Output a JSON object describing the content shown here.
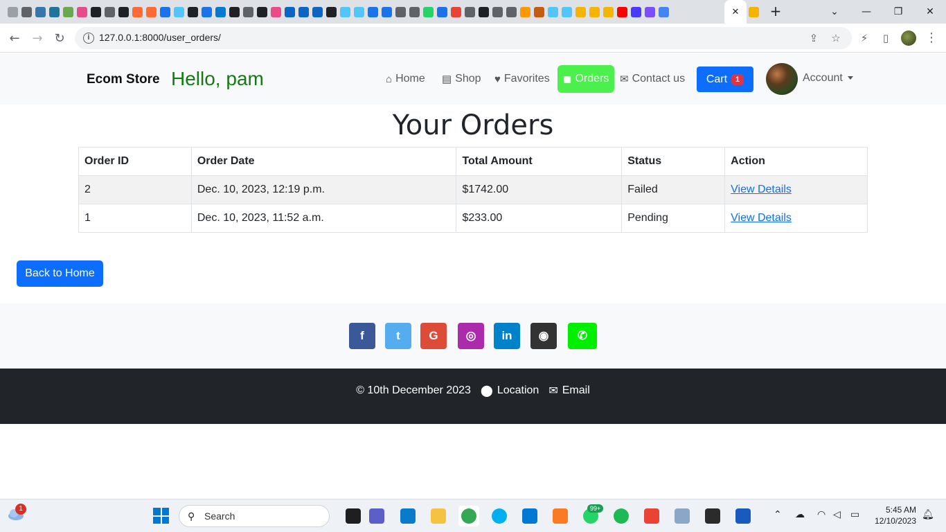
{
  "browser": {
    "url": "127.0.0.1:8000/user_orders/",
    "tab_close": "✕",
    "new_tab": "+"
  },
  "site": {
    "brand": "Ecom Store",
    "greeting": "Hello, pam",
    "nav": {
      "home": "Home",
      "shop": "Shop",
      "favorites": "Favorites",
      "orders": "Orders",
      "contact": "Contact us"
    },
    "cart_label": "Cart",
    "cart_count": "1",
    "account_label": "Account",
    "colors": {
      "primary": "#0d6efd",
      "active_nav": "#4cf04c",
      "greeting": "#157a15",
      "badge": "#dc3545",
      "footer_dark": "#212529"
    }
  },
  "main": {
    "title": "Your Orders",
    "table": {
      "headers": [
        "Order ID",
        "Order Date",
        "Total Amount",
        "Status",
        "Action"
      ],
      "rows": [
        {
          "id": "2",
          "date": "Dec. 10, 2023, 12:19 p.m.",
          "total": "$1742.00",
          "status": "Failed",
          "action": "View Details"
        },
        {
          "id": "1",
          "date": "Dec. 10, 2023, 11:52 a.m.",
          "total": "$233.00",
          "status": "Pending",
          "action": "View Details"
        }
      ]
    },
    "back_button": "Back to Home"
  },
  "footer": {
    "social": [
      {
        "name": "facebook",
        "glyph": "f",
        "color": "#3b5998"
      },
      {
        "name": "twitter",
        "glyph": "t",
        "color": "#55acee"
      },
      {
        "name": "google",
        "glyph": "G",
        "color": "#dd4b39"
      },
      {
        "name": "instagram",
        "glyph": "◎",
        "color": "#ac2bac"
      },
      {
        "name": "linkedin",
        "glyph": "in",
        "color": "#0082ca"
      },
      {
        "name": "github",
        "glyph": "◉",
        "color": "#333333"
      },
      {
        "name": "phone",
        "glyph": "✆",
        "color": "#00ee00"
      }
    ],
    "copyright": "© 10th December 2023",
    "location": "Location",
    "email": "Email"
  },
  "taskbar": {
    "weather_badge": "1",
    "search_placeholder": "Search",
    "whatsapp_badge": "99+",
    "time": "5:45 AM",
    "date": "12/10/2023"
  }
}
